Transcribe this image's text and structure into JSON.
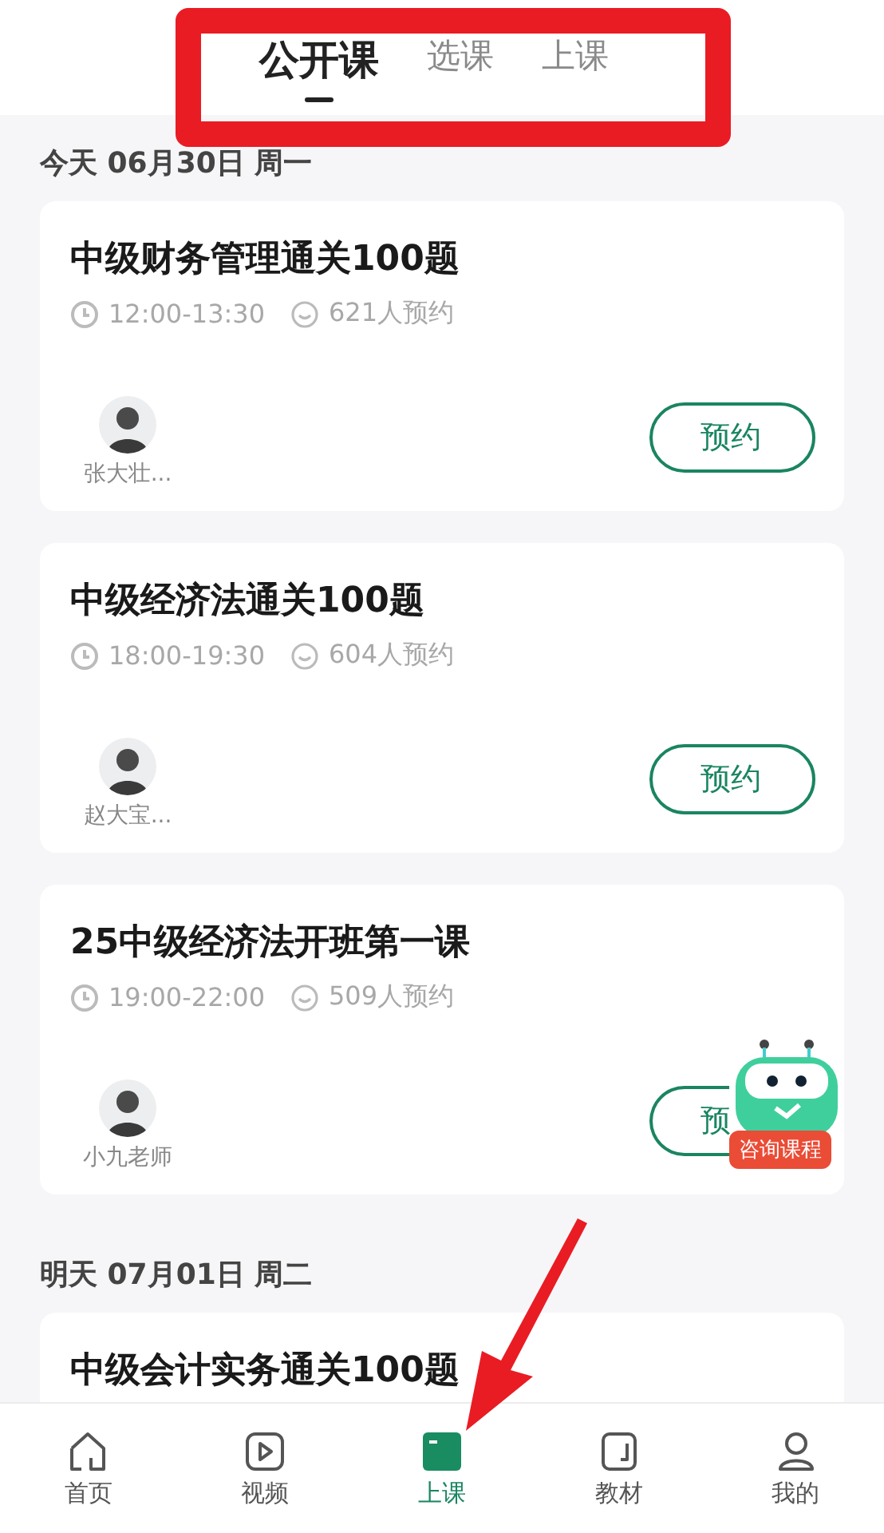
{
  "tabs": [
    {
      "label": "公开课",
      "selected": true
    },
    {
      "label": "选课",
      "selected": false
    },
    {
      "label": "上课",
      "selected": false
    }
  ],
  "days": [
    {
      "date": "今天 06月30日 周一",
      "courses": [
        {
          "title": "中级财务管理通关100题",
          "time": "12:00-13:30",
          "booked": "621人预约",
          "teacher": "张大壮...",
          "button": "预约"
        },
        {
          "title": "中级经济法通关100题",
          "time": "18:00-19:30",
          "booked": "604人预约",
          "teacher": "赵大宝...",
          "button": "预约"
        },
        {
          "title": "25中级经济法开班第一课",
          "time": "19:00-22:00",
          "booked": "509人预约",
          "teacher": "小九老师",
          "button": "预",
          "obscured": true
        }
      ]
    },
    {
      "date": "明天 07月01日 周二",
      "courses": [
        {
          "title": "中级会计实务通关100题"
        }
      ]
    }
  ],
  "assistant": {
    "badge": "咨询课程"
  },
  "nav": [
    {
      "label": "首页",
      "kind": "home",
      "selected": false
    },
    {
      "label": "视频",
      "kind": "video",
      "selected": false
    },
    {
      "label": "上课",
      "kind": "class",
      "selected": true
    },
    {
      "label": "教材",
      "kind": "book",
      "selected": false
    },
    {
      "label": "我的",
      "kind": "user",
      "selected": false
    }
  ]
}
